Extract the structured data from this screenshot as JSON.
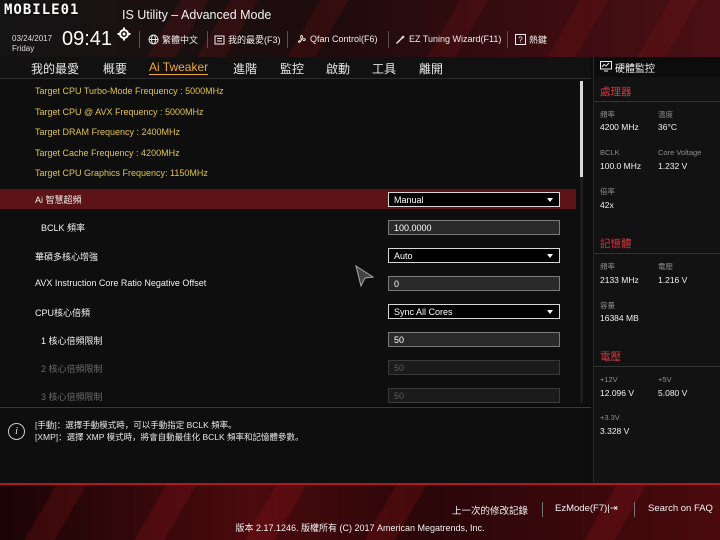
{
  "header": {
    "logo_text": "MOBILE01",
    "title": "IS Utility – Advanced Mode",
    "date": "03/24/2017",
    "day": "Friday",
    "time": "09:41",
    "buttons": [
      {
        "label": "繁體中文",
        "icon": "globe-icon"
      },
      {
        "label": "我的最愛(F3)",
        "icon": "favorites-icon"
      },
      {
        "label": "Qfan Control(F6)",
        "icon": "fan-icon"
      },
      {
        "label": "EZ Tuning Wizard(F11)",
        "icon": "wizard-icon"
      },
      {
        "label": "熱鍵",
        "icon": "hotkey-icon"
      }
    ]
  },
  "tabs": [
    "我的最愛",
    "概要",
    "Ai Tweaker",
    "進階",
    "監控",
    "啟動",
    "工具",
    "離開"
  ],
  "active_tab": "Ai Tweaker",
  "info_lines": [
    "Target CPU Turbo-Mode Frequency : 5000MHz",
    "Target CPU @ AVX Frequency : 5000MHz",
    "Target DRAM Frequency : 2400MHz",
    "Target Cache Frequency : 4200MHz",
    "Target CPU Graphics Frequency: 1150MHz"
  ],
  "settings": [
    {
      "label": "Ai 智慧超頻",
      "type": "select",
      "value": "Manual",
      "highlight": true
    },
    {
      "label": "BCLK 頻率",
      "type": "input",
      "value": "100.0000"
    },
    {
      "label": "華碩多核心增強",
      "type": "select",
      "value": "Auto"
    },
    {
      "label": "AVX Instruction Core Ratio Negative Offset",
      "type": "input",
      "value": "0"
    },
    {
      "label": "CPU核心倍頻",
      "type": "select",
      "value": "Sync All Cores"
    },
    {
      "label": "1 核心倍頻限制",
      "type": "input",
      "value": "50"
    },
    {
      "label": "2 核心倍頻限制",
      "type": "input",
      "value": "50",
      "disabled": true
    },
    {
      "label": "3 核心倍頻限制",
      "type": "input",
      "value": "50",
      "disabled": true
    }
  ],
  "help": {
    "lines": [
      "[手動]：選擇手動模式時，可以手動指定 BCLK 頻率。",
      "[XMP]：選擇 XMP 模式時，將會自動最佳化 BCLK 頻率和記憶體參數。"
    ]
  },
  "hw_monitor": {
    "title": "硬體監控",
    "sections": [
      {
        "name": "處理器",
        "items": [
          {
            "label": "頻率",
            "value": "4200 MHz"
          },
          {
            "label": "溫度",
            "value": "36°C"
          },
          {
            "label": "BCLK",
            "value": "100.0 MHz"
          },
          {
            "label": "Core Voltage",
            "value": "1.232 V"
          },
          {
            "label": "倍率",
            "value": "42x"
          }
        ]
      },
      {
        "name": "記憶體",
        "items": [
          {
            "label": "頻率",
            "value": "2133 MHz"
          },
          {
            "label": "電壓",
            "value": "1.216 V"
          },
          {
            "label": "容量",
            "value": "16384 MB"
          }
        ]
      },
      {
        "name": "電壓",
        "items": [
          {
            "label": "+12V",
            "value": "12.096 V"
          },
          {
            "label": "+5V",
            "value": "5.080 V"
          },
          {
            "label": "+3.3V",
            "value": "3.328 V"
          }
        ]
      }
    ]
  },
  "footer": {
    "last_modified": "上一次的修改記錄",
    "ezmode": "EzMode(F7)|⇥",
    "search": "Search on FAQ",
    "copyright": "版本 2.17.1246. 版權所有 (C) 2017 American Megatrends, Inc."
  },
  "colors": {
    "accent_red": "#d9363e",
    "active_tab": "#f0a83a",
    "info_text": "#e0c34c",
    "highlight_row": "#5d1416"
  }
}
